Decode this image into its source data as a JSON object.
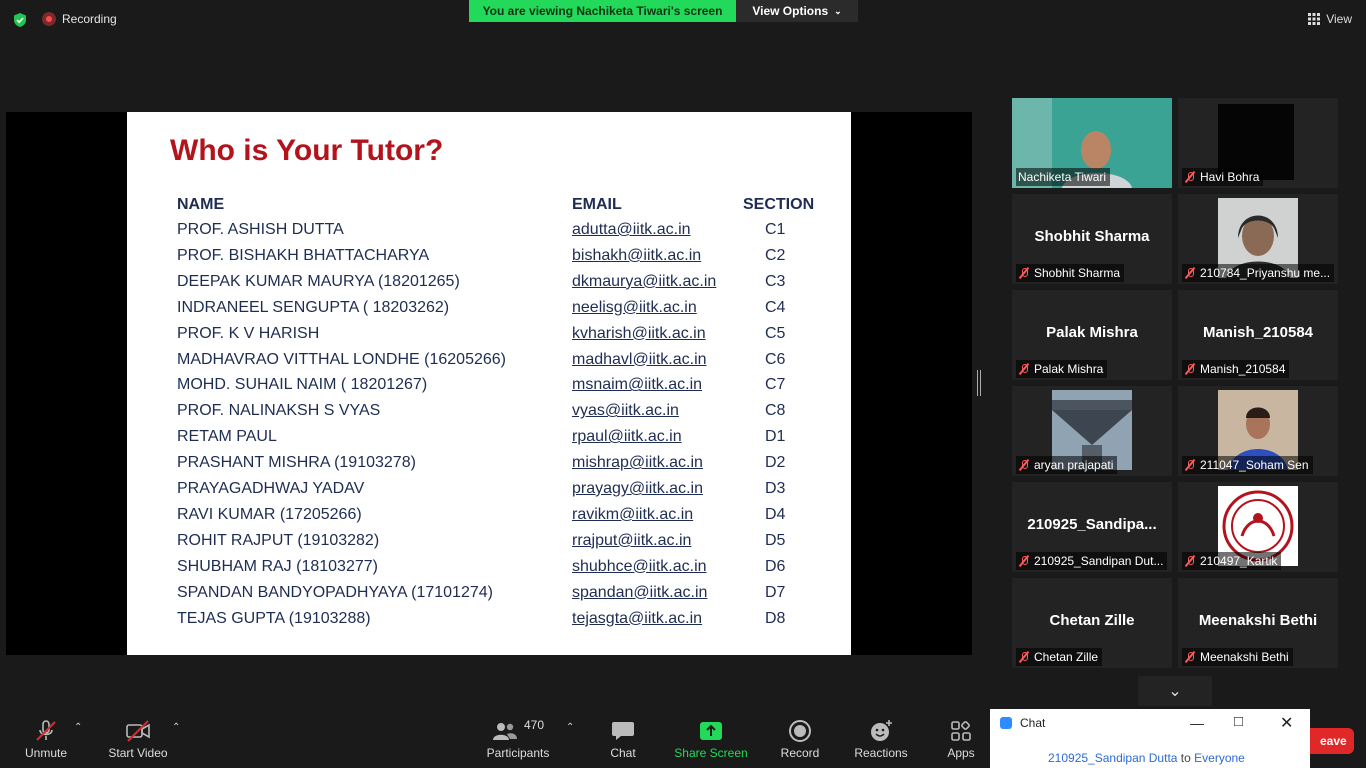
{
  "top": {
    "recording": "Recording",
    "banner": "You are viewing Nachiketa Tiwari's screen",
    "view_options": "View Options",
    "view": "View"
  },
  "slide": {
    "title": "Who is Your Tutor?",
    "headers": {
      "name": "NAME",
      "email": "EMAIL",
      "section": "SECTION"
    },
    "rows": [
      {
        "name": "PROF. ASHISH DUTTA",
        "email": "adutta@iitk.ac.in",
        "section": "C1"
      },
      {
        "name": "PROF. BISHAKH BHATTACHARYA",
        "email": "bishakh@iitk.ac.in",
        "section": "C2"
      },
      {
        "name": "DEEPAK KUMAR MAURYA (18201265)",
        "email": "dkmaurya@iitk.ac.in",
        "section": "C3"
      },
      {
        "name": "INDRANEEL SENGUPTA ( 18203262)",
        "email": "neelisg@iitk.ac.in",
        "section": "C4"
      },
      {
        "name": "PROF. K V HARISH",
        "email": "kvharish@iitk.ac.in",
        "section": "C5"
      },
      {
        "name": "MADHAVRAO VITTHAL LONDHE (16205266)",
        "email": "madhavl@iitk.ac.in",
        "section": "C6"
      },
      {
        "name": "MOHD. SUHAIL NAIM ( 18201267)",
        "email": "msnaim@iitk.ac.in",
        "section": "C7"
      },
      {
        "name": "PROF. NALINAKSH S  VYAS",
        "email": "vyas@iitk.ac.in",
        "section": "C8"
      },
      {
        "name": "RETAM PAUL",
        "email": "rpaul@iitk.ac.in",
        "section": "D1"
      },
      {
        "name": "PRASHANT MISHRA (19103278)",
        "email": "mishrap@iitk.ac.in",
        "section": "D2"
      },
      {
        "name": "PRAYAGADHWAJ YADAV",
        "email": "prayagy@iitk.ac.in",
        "section": "D3"
      },
      {
        "name": "RAVI KUMAR (17205266)",
        "email": "ravikm@iitk.ac.in",
        "section": "D4"
      },
      {
        "name": "ROHIT RAJPUT (19103282)",
        "email": "rrajput@iitk.ac.in",
        "section": "D5"
      },
      {
        "name": "SHUBHAM RAJ (18103277)",
        "email": "shubhce@iitk.ac.in",
        "section": "D6"
      },
      {
        "name": "SPANDAN BANDYOPADHYAYA (17101274)",
        "email": "spandan@iitk.ac.in",
        "section": "D7"
      },
      {
        "name": "TEJAS GUPTA (19103288)",
        "email": "tejasgta@iitk.ac.in",
        "section": "D8"
      }
    ]
  },
  "gallery": {
    "tiles": [
      {
        "label": "Nachiketa Tiwari",
        "big": "",
        "muted": false
      },
      {
        "label": "Havi Bohra",
        "big": "",
        "muted": true
      },
      {
        "label": "Shobhit Sharma",
        "big": "Shobhit Sharma",
        "muted": true
      },
      {
        "label": "210784_Priyanshu me...",
        "big": "",
        "muted": true
      },
      {
        "label": "Palak Mishra",
        "big": "Palak Mishra",
        "muted": true
      },
      {
        "label": "Manish_210584",
        "big": "Manish_210584",
        "muted": true
      },
      {
        "label": "aryan prajapati",
        "big": "",
        "muted": true
      },
      {
        "label": "211047_Soham Sen",
        "big": "",
        "muted": true
      },
      {
        "label": "210925_Sandipan Dut...",
        "big": "210925_Sandipa...",
        "muted": true
      },
      {
        "label": "210497_Kartik",
        "big": "",
        "muted": true
      },
      {
        "label": "Chetan Zille",
        "big": "Chetan Zille",
        "muted": true
      },
      {
        "label": "Meenakshi Bethi",
        "big": "Meenakshi Bethi",
        "muted": true
      }
    ]
  },
  "toolbar": {
    "unmute": "Unmute",
    "start_video": "Start Video",
    "participants": "Participants",
    "participants_count": "470",
    "chat": "Chat",
    "share_screen": "Share Screen",
    "record": "Record",
    "reactions": "Reactions",
    "apps": "Apps",
    "leave": "eave"
  },
  "chat": {
    "title": "Chat",
    "sender": "210925_Sandipan Dutta",
    "to": "to",
    "recipient": "Everyone"
  }
}
